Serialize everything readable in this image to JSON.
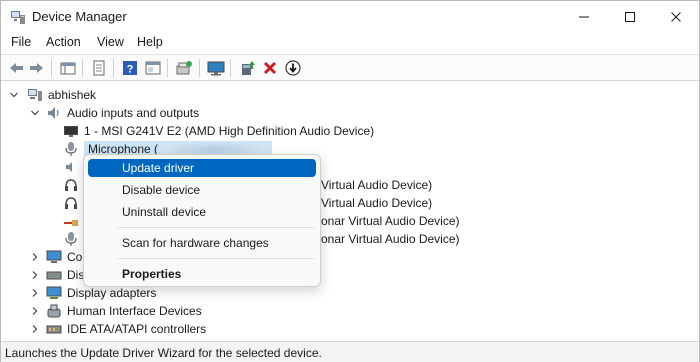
{
  "window": {
    "title": "Device Manager"
  },
  "menu": [
    "File",
    "Action",
    "View",
    "Help"
  ],
  "toolbar": {
    "icons": [
      "back-arrow-icon",
      "forward-arrow-icon",
      "show-hide-console-tree-icon",
      "properties-icon",
      "help-icon",
      "action-pane-icon",
      "scan-hardware-icon",
      "monitor-icon",
      "update-driver-icon",
      "uninstall-device-icon",
      "disable-device-icon"
    ]
  },
  "tree": {
    "root": "abhishek",
    "category_audio": "Audio inputs and outputs",
    "device_1": "1 - MSI G241V E2 (AMD High Definition Audio Device)",
    "device_mic": "Microphone (",
    "device_partial_1": "Virtual Audio Device)",
    "device_partial_2": "Virtual Audio Device)",
    "device_partial_3": "onar Virtual Audio Device)",
    "device_partial_4": "onar Virtual Audio Device)",
    "cat_computer_partial": "Com",
    "cat_disk_partial": "Disk",
    "cat_display": "Display adapters",
    "cat_hid": "Human Interface Devices",
    "cat_ide": "IDE ATA/ATAPI controllers"
  },
  "context_menu": {
    "update_driver": "Update driver",
    "disable_device": "Disable device",
    "uninstall_device": "Uninstall device",
    "scan_hardware": "Scan for hardware changes",
    "properties": "Properties"
  },
  "status": {
    "text": "Launches the Update Driver Wizard for the selected device."
  },
  "colors": {
    "accent": "#0067c0",
    "selection": "#cce4f7"
  }
}
